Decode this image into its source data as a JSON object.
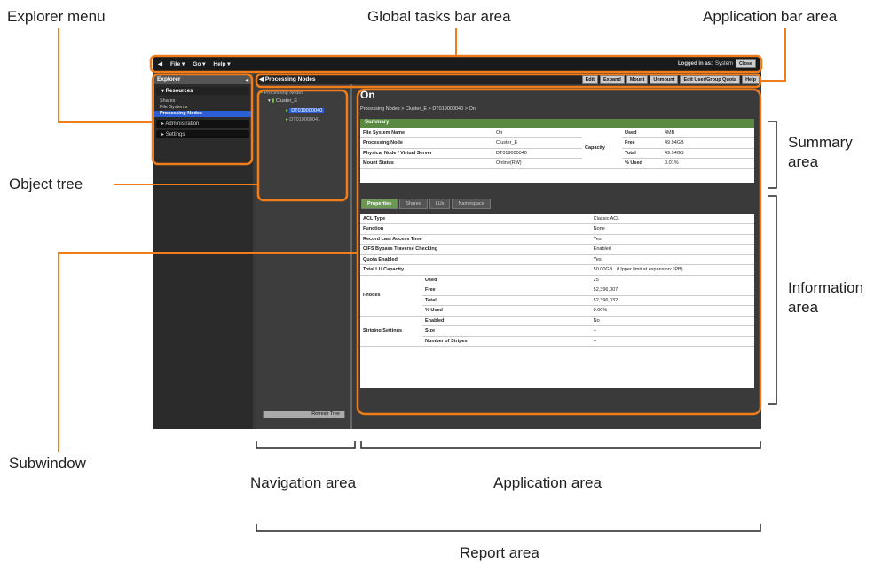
{
  "callouts": {
    "explorer_menu": "Explorer menu",
    "global_tasks_bar": "Global tasks bar area",
    "application_bar": "Application bar area",
    "object_tree": "Object tree",
    "summary_area": "Summary area",
    "information_area": "Information area",
    "subwindow": "Subwindow",
    "navigation_area": "Navigation area",
    "application_area": "Application area",
    "report_area": "Report area"
  },
  "global_bar": {
    "menu": [
      "File",
      "Go",
      "Help"
    ],
    "logged_label": "Logged in as:",
    "user": "System",
    "close": "Close"
  },
  "explorer": {
    "title": "Explorer",
    "resources": "Resources",
    "items": [
      "Shares",
      "File Systems",
      "Processing Nodes"
    ],
    "administration": "Administration",
    "settings": "Settings"
  },
  "tree": {
    "root": "Processing Nodes",
    "cluster": "Cluster_E",
    "nodes": [
      "DT019000040",
      "DT019000041"
    ],
    "refresh": "Refresh Tree"
  },
  "app_bar": {
    "title": "Processing Nodes",
    "buttons": [
      "Edit",
      "Expand",
      "Mount",
      "Unmount",
      "Edit User/Group Quota",
      "Help"
    ]
  },
  "app": {
    "title": "On",
    "breadcrumb": "Processing Nodes > Cluster_E > DT019000040 > On",
    "summary_title": "Summary",
    "summary": {
      "fs_label": "File System Name",
      "fs": "On",
      "pn_label": "Processing Node",
      "pn": "Cluster_E",
      "phys_label": "Physical Node / Virtual Server",
      "phys": "DT019000040",
      "mount_label": "Mount Status",
      "mount": "Online(RW)",
      "capacity_label": "Capacity",
      "used_label": "Used",
      "used": "4MB",
      "free_label": "Free",
      "free": "49.94GB",
      "total_label": "Total",
      "total": "49.94GB",
      "pct_label": "% Used",
      "pct": "0.01%"
    },
    "tabs": [
      "Properties",
      "Shares",
      "LUs",
      "Namespace"
    ],
    "props": {
      "acl_label": "ACL Type",
      "acl": "Classic ACL",
      "func_label": "Function",
      "func": "None",
      "rlat_label": "Record Last Access Time",
      "rlat": "Yes",
      "cifs_label": "CIFS Bypass Traverse Checking",
      "cifs": "Enabled",
      "quota_label": "Quota Enabled",
      "quota": "Yes",
      "tlu_label": "Total LU Capacity",
      "tlu": "50.00GB",
      "tlu_note": "(Upper limit at expansion:1PB)",
      "inodes_label": "i-nodes",
      "iused_label": "Used",
      "iused": "25",
      "ifree_label": "Free",
      "ifree": "52,396,007",
      "itotal_label": "Total",
      "itotal": "52,396,032",
      "ipct_label": "% Used",
      "ipct": "0.00%",
      "strip_label": "Striping Settings",
      "senabled_label": "Enabled",
      "senabled": "No",
      "ssize_label": "Size",
      "ssize": "--",
      "snum_label": "Number of Stripes",
      "snum": "--"
    }
  },
  "colors": {
    "annotation": "#f07d1a",
    "selection": "#2c5fd6",
    "header_green": "#5a8a42"
  }
}
